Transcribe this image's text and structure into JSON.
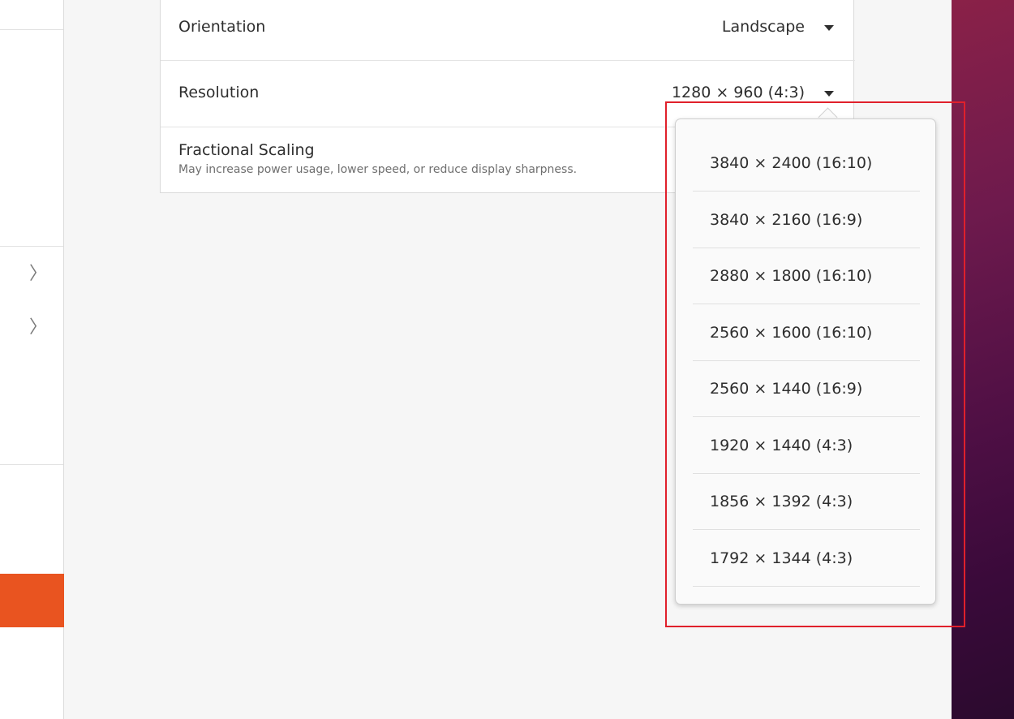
{
  "display": {
    "orientation": {
      "label": "Orientation",
      "value": "Landscape"
    },
    "resolution": {
      "label": "Resolution",
      "value": "1280 × 960 (4:3)"
    },
    "fractional_scaling": {
      "label": "Fractional Scaling",
      "description": "May increase power usage, lower speed, or reduce display sharpness."
    }
  },
  "resolution_options": [
    "3840 × 2400 (16:10)",
    "3840 × 2160 (16:9)",
    "2880 × 1800 (16:10)",
    "2560 × 1600 (16:10)",
    "2560 × 1440 (16:9)",
    "1920 × 1440 (4:3)",
    "1856 × 1392 (4:3)",
    "1792 × 1344 (4:3)"
  ],
  "colors": {
    "accent": "#e95420",
    "highlight_box": "#e0202b"
  }
}
